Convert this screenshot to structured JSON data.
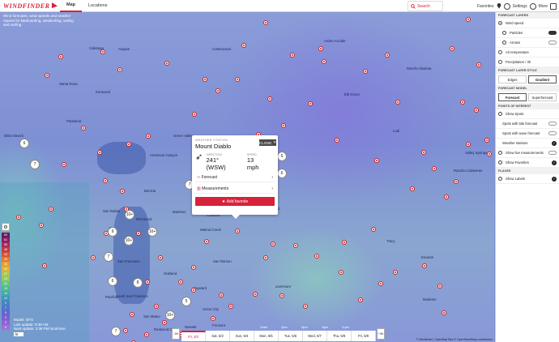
{
  "app": {
    "logo_text": "WINDFINDER"
  },
  "nav": {
    "tabs": [
      {
        "label": "Map"
      },
      {
        "label": "Locations"
      }
    ]
  },
  "topbar": {
    "search_label": "Search",
    "favorites_label": "Favorites",
    "settings_label": "Settings",
    "more_label": "More"
  },
  "intro_text": "Wind forecasts, wind speeds and weather reports for kiteboarding, windsurfing, sailing and surfing",
  "cities": [
    "Cottonwood",
    "Arden-Arcade",
    "Calistoga",
    "Angwin",
    "Rancho Murieta",
    "Santa Rosa",
    "Kenwood",
    "Elk Grove",
    "Jackson",
    "Petaluma",
    "Green Valley",
    "Lodi",
    "Dillon Beach",
    "American Canyon",
    "Valley Springs",
    "Rancho Calaveras",
    "Benicia",
    "Brentwood",
    "San Rafael",
    "Richmond",
    "Martinez",
    "Concord",
    "Walnut Creek",
    "Tracy",
    "San Francisco",
    "Oakland",
    "San Ramon",
    "Livermore",
    "Escalon",
    "Hayward",
    "Modesto",
    "Pacifica",
    "South San Francisco",
    "Union City",
    "Fremont",
    "San Mateo",
    "Redwood City",
    "Newark"
  ],
  "popup": {
    "close_label": "CLOSE",
    "subtitle": "WEATHER STATION",
    "title": "Mount Diablo",
    "direction_label": "DIRECTION",
    "direction_value": "241° (WSW)",
    "speed_label": "SPEED",
    "speed_value": "13 mph",
    "forecast_label": "Forecast",
    "measurements_label": "Measurements",
    "favorite_label": "Add favorite"
  },
  "clusters": [
    "6",
    "7",
    "7",
    "6",
    "6",
    "10+",
    "9",
    "10+",
    "10+",
    "7",
    "6",
    "8",
    "5",
    "10+",
    "7"
  ],
  "panel": {
    "layers_title": "FORECAST LAYERS",
    "wind_speed": "Wind speed",
    "particles": "Particles",
    "arrows": "Arrows",
    "air_temp": "Air temperature",
    "precip": "Precipitation / 3h",
    "style_title": "FORECAST LAYER STYLE",
    "edges": "Edges",
    "gradient": "Gradient",
    "model_title": "FORECAST MODEL",
    "forecast": "Forecast",
    "superforecast": "Superforecast",
    "poi_title": "POINTS OF INTEREST",
    "show_spots": "Show Spots",
    "tide": "Spots with tide forecast",
    "wave": "Spots with wave forecast",
    "weather_stations": "Weather stations",
    "live": "Show live measurements",
    "show_fav": "Show Favorites",
    "places_title": "PLACES",
    "show_labels": "Show Labels"
  },
  "legend": {
    "values": [
      "65",
      "61",
      "55",
      "48",
      "43",
      "38",
      "34",
      "30",
      "27",
      "24",
      "21",
      "18",
      "15",
      "12",
      "9",
      "7",
      "5",
      "3",
      "2",
      "0"
    ],
    "colors": [
      "#6a1a5e",
      "#8a1e66",
      "#a62b58",
      "#c4384b",
      "#d8543a",
      "#e27a31",
      "#e79e2e",
      "#d8b43a",
      "#b6c24c",
      "#8ecb62",
      "#68c67a",
      "#4cba92",
      "#3faca8",
      "#3d98b8",
      "#4585c4",
      "#5474cc",
      "#6366d0",
      "#7a60d2",
      "#8e64d4",
      "#a070d6"
    ]
  },
  "model": {
    "line1": "Model: GFS",
    "line2": "Last update: 9:38 AM",
    "line3": "Next update: 3:38 PM local time",
    "unit": "kt"
  },
  "timeline": {
    "prev": "-3h",
    "next": "+3h",
    "hours": [
      "11am",
      "2pm",
      "5pm",
      "8pm",
      "11pm"
    ],
    "days": [
      "Fri, 5/2",
      "Sat, 5/3",
      "Sun, 5/4",
      "Mon, 5/5",
      "Tue, 5/6",
      "Wed, 5/7",
      "Thu, 5/8",
      "Fri, 5/9"
    ]
  },
  "attribution": "© Windfinder | OpenMapTiles © OpenStreetMap contributors"
}
